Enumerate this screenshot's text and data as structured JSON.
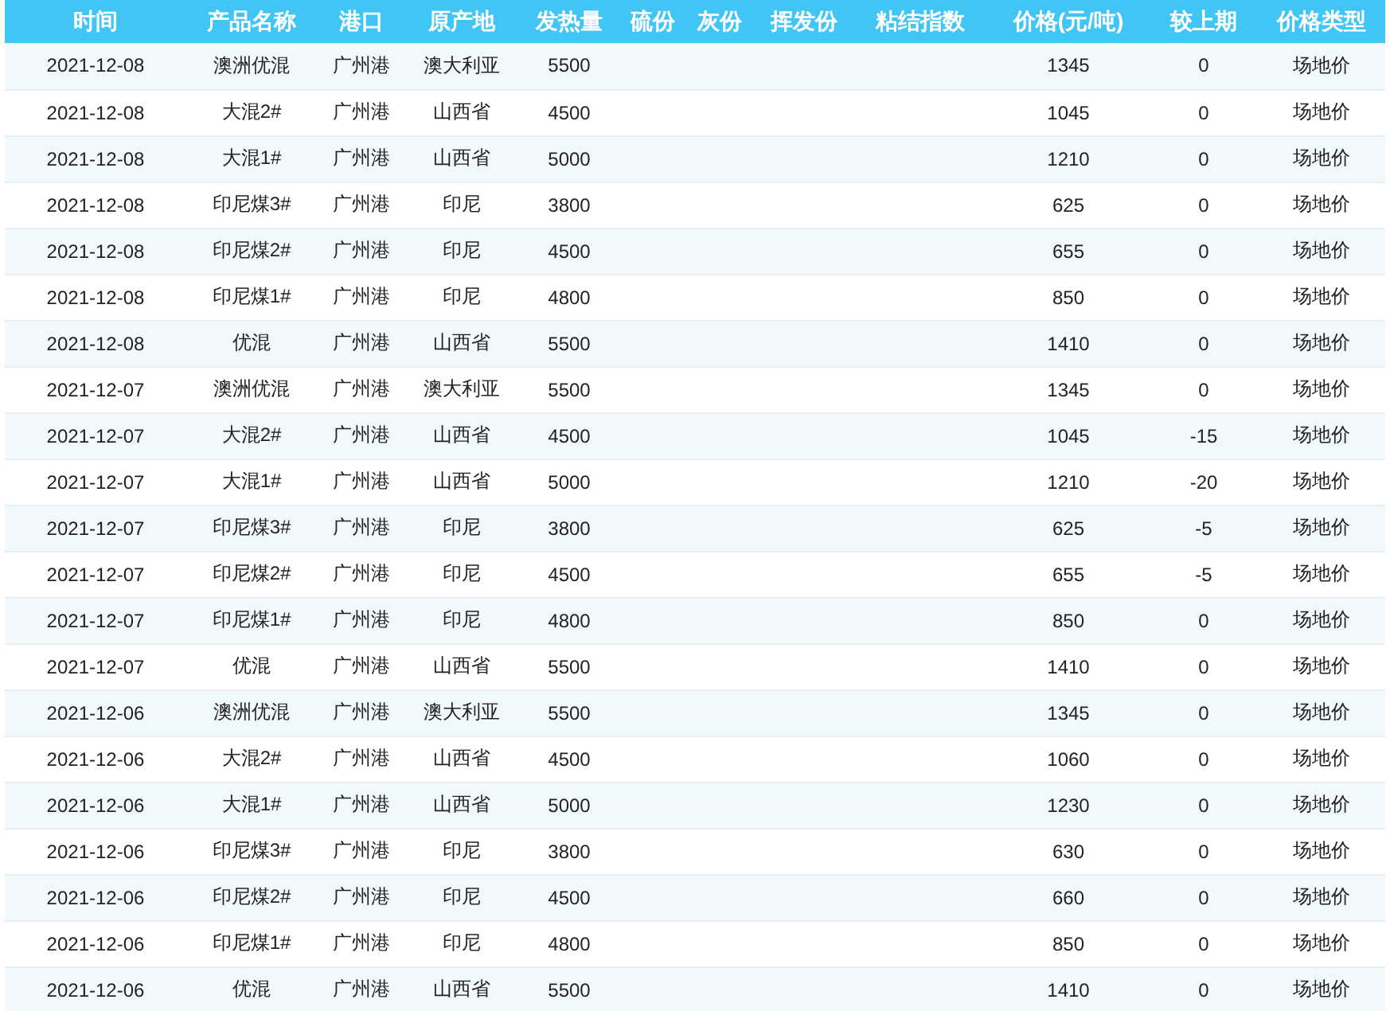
{
  "table": {
    "columns": [
      "时间",
      "产品名称",
      "港口",
      "原产地",
      "发热量",
      "硫份",
      "灰份",
      "挥发份",
      "粘结指数",
      "价格(元/吨)",
      "较上期",
      "价格类型"
    ],
    "rows": [
      {
        "date": "2021-12-08",
        "product": "澳洲优混",
        "port": "广州港",
        "origin": "澳大利亚",
        "calorific": "5500",
        "price": "1345",
        "change": "0",
        "price_type": "场地价"
      },
      {
        "date": "2021-12-08",
        "product": "大混2#",
        "port": "广州港",
        "origin": "山西省",
        "calorific": "4500",
        "price": "1045",
        "change": "0",
        "price_type": "场地价"
      },
      {
        "date": "2021-12-08",
        "product": "大混1#",
        "port": "广州港",
        "origin": "山西省",
        "calorific": "5000",
        "price": "1210",
        "change": "0",
        "price_type": "场地价"
      },
      {
        "date": "2021-12-08",
        "product": "印尼煤3#",
        "port": "广州港",
        "origin": "印尼",
        "calorific": "3800",
        "price": "625",
        "change": "0",
        "price_type": "场地价"
      },
      {
        "date": "2021-12-08",
        "product": "印尼煤2#",
        "port": "广州港",
        "origin": "印尼",
        "calorific": "4500",
        "price": "655",
        "change": "0",
        "price_type": "场地价"
      },
      {
        "date": "2021-12-08",
        "product": "印尼煤1#",
        "port": "广州港",
        "origin": "印尼",
        "calorific": "4800",
        "price": "850",
        "change": "0",
        "price_type": "场地价"
      },
      {
        "date": "2021-12-08",
        "product": "优混",
        "port": "广州港",
        "origin": "山西省",
        "calorific": "5500",
        "price": "1410",
        "change": "0",
        "price_type": "场地价"
      },
      {
        "date": "2021-12-07",
        "product": "澳洲优混",
        "port": "广州港",
        "origin": "澳大利亚",
        "calorific": "5500",
        "price": "1345",
        "change": "0",
        "price_type": "场地价"
      },
      {
        "date": "2021-12-07",
        "product": "大混2#",
        "port": "广州港",
        "origin": "山西省",
        "calorific": "4500",
        "price": "1045",
        "change": "-15",
        "price_type": "场地价"
      },
      {
        "date": "2021-12-07",
        "product": "大混1#",
        "port": "广州港",
        "origin": "山西省",
        "calorific": "5000",
        "price": "1210",
        "change": "-20",
        "price_type": "场地价"
      },
      {
        "date": "2021-12-07",
        "product": "印尼煤3#",
        "port": "广州港",
        "origin": "印尼",
        "calorific": "3800",
        "price": "625",
        "change": "-5",
        "price_type": "场地价"
      },
      {
        "date": "2021-12-07",
        "product": "印尼煤2#",
        "port": "广州港",
        "origin": "印尼",
        "calorific": "4500",
        "price": "655",
        "change": "-5",
        "price_type": "场地价"
      },
      {
        "date": "2021-12-07",
        "product": "印尼煤1#",
        "port": "广州港",
        "origin": "印尼",
        "calorific": "4800",
        "price": "850",
        "change": "0",
        "price_type": "场地价"
      },
      {
        "date": "2021-12-07",
        "product": "优混",
        "port": "广州港",
        "origin": "山西省",
        "calorific": "5500",
        "price": "1410",
        "change": "0",
        "price_type": "场地价"
      },
      {
        "date": "2021-12-06",
        "product": "澳洲优混",
        "port": "广州港",
        "origin": "澳大利亚",
        "calorific": "5500",
        "price": "1345",
        "change": "0",
        "price_type": "场地价"
      },
      {
        "date": "2021-12-06",
        "product": "大混2#",
        "port": "广州港",
        "origin": "山西省",
        "calorific": "4500",
        "price": "1060",
        "change": "0",
        "price_type": "场地价"
      },
      {
        "date": "2021-12-06",
        "product": "大混1#",
        "port": "广州港",
        "origin": "山西省",
        "calorific": "5000",
        "price": "1230",
        "change": "0",
        "price_type": "场地价"
      },
      {
        "date": "2021-12-06",
        "product": "印尼煤3#",
        "port": "广州港",
        "origin": "印尼",
        "calorific": "3800",
        "price": "630",
        "change": "0",
        "price_type": "场地价"
      },
      {
        "date": "2021-12-06",
        "product": "印尼煤2#",
        "port": "广州港",
        "origin": "印尼",
        "calorific": "4500",
        "price": "660",
        "change": "0",
        "price_type": "场地价"
      },
      {
        "date": "2021-12-06",
        "product": "印尼煤1#",
        "port": "广州港",
        "origin": "印尼",
        "calorific": "4800",
        "price": "850",
        "change": "0",
        "price_type": "场地价"
      },
      {
        "date": "2021-12-06",
        "product": "优混",
        "port": "广州港",
        "origin": "山西省",
        "calorific": "5500",
        "price": "1410",
        "change": "0",
        "price_type": "场地价"
      }
    ]
  }
}
